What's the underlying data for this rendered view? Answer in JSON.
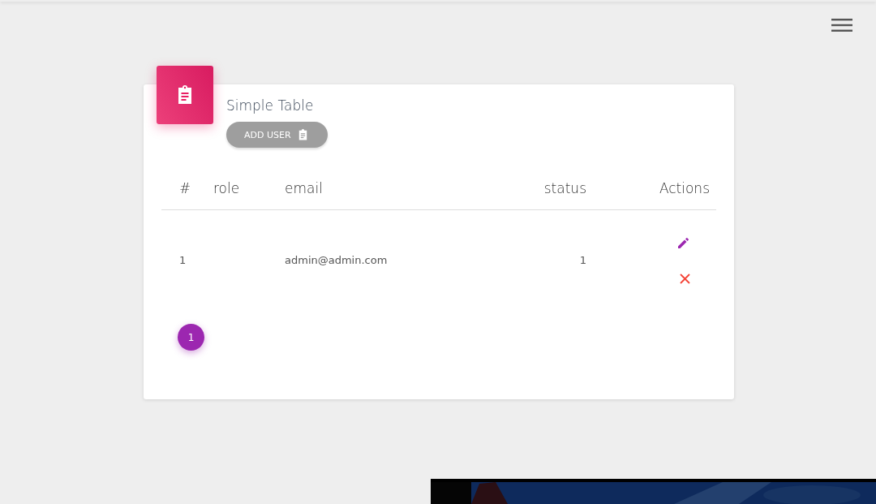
{
  "card": {
    "title": "Simple Table",
    "add_button": "ADD USER"
  },
  "table": {
    "columns": [
      "#",
      "role",
      "email",
      "status",
      "Actions"
    ],
    "rows": [
      {
        "number": "1",
        "email": "admin@admin.com",
        "status": "1"
      }
    ]
  },
  "pagination": [
    {
      "label": "1",
      "selected": true
    }
  ]
}
